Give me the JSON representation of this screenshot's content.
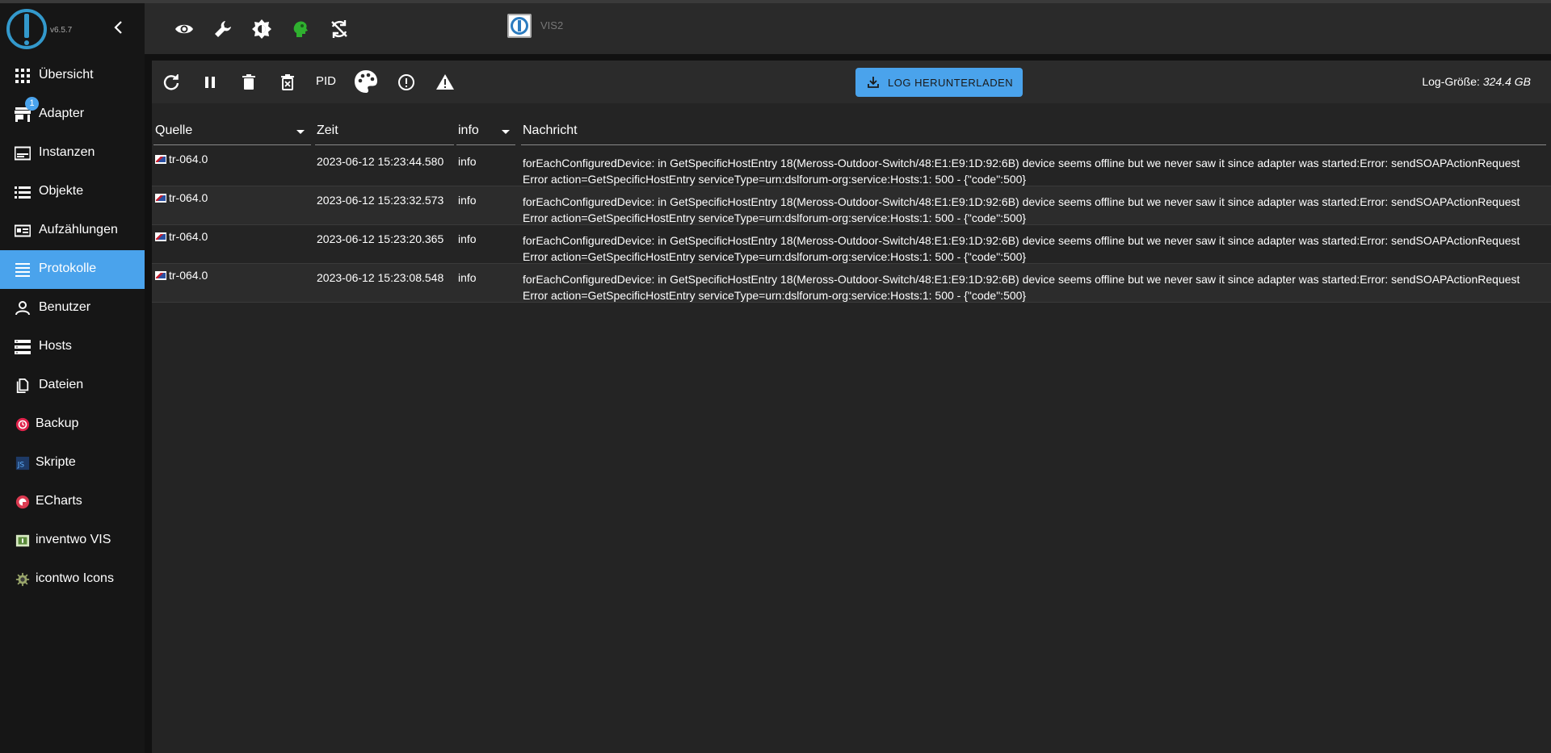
{
  "app": {
    "version": "v6.5.7"
  },
  "sidebar": {
    "items": [
      {
        "label": "Übersicht",
        "icon": "grid-icon"
      },
      {
        "label": "Adapter",
        "icon": "store-icon",
        "badge": "1"
      },
      {
        "label": "Instanzen",
        "icon": "instances-icon"
      },
      {
        "label": "Objekte",
        "icon": "list-icon"
      },
      {
        "label": "Aufzählungen",
        "icon": "enum-icon"
      },
      {
        "label": "Protokolle",
        "icon": "log-icon",
        "active": true
      },
      {
        "label": "Benutzer",
        "icon": "user-icon"
      },
      {
        "label": "Hosts",
        "icon": "hosts-icon"
      },
      {
        "label": "Dateien",
        "icon": "files-icon"
      },
      {
        "label": "Backup",
        "icon": "backup-icon"
      },
      {
        "label": "Skripte",
        "icon": "js-icon"
      },
      {
        "label": "ECharts",
        "icon": "echarts-icon"
      },
      {
        "label": "inventwo VIS",
        "icon": "inventwo-icon"
      },
      {
        "label": "icontwo Icons",
        "icon": "icontwo-icon"
      }
    ]
  },
  "header": {
    "vis2_label": "VIS2"
  },
  "toolbar": {
    "pid_label": "PID",
    "download_label": "LOG HERUNTERLADEN",
    "logsize_label": "Log-Größe:",
    "logsize_value": "324.4 GB"
  },
  "table": {
    "columns": {
      "source": "Quelle",
      "time": "Zeit",
      "severity": "info",
      "message": "Nachricht"
    },
    "rows": [
      {
        "source": "tr-064.0",
        "time": "2023-06-12 15:23:44.580",
        "severity": "info",
        "msg1": "forEachConfiguredDevice: in GetSpecificHostEntry 18(Meross-Outdoor-Switch/48:E1:E9:1D:92:6B) device seems offline but we never saw it since adapter was started:Error: sendSOAPActionRequest",
        "msg2": "Error action=GetSpecificHostEntry serviceType=urn:dslforum-org:service:Hosts:1: 500 - {\"code\":500}"
      },
      {
        "source": "tr-064.0",
        "time": "2023-06-12 15:23:32.573",
        "severity": "info",
        "msg1": "forEachConfiguredDevice: in GetSpecificHostEntry 18(Meross-Outdoor-Switch/48:E1:E9:1D:92:6B) device seems offline but we never saw it since adapter was started:Error: sendSOAPActionRequest",
        "msg2": "Error action=GetSpecificHostEntry serviceType=urn:dslforum-org:service:Hosts:1: 500 - {\"code\":500}"
      },
      {
        "source": "tr-064.0",
        "time": "2023-06-12 15:23:20.365",
        "severity": "info",
        "msg1": "forEachConfiguredDevice: in GetSpecificHostEntry 18(Meross-Outdoor-Switch/48:E1:E9:1D:92:6B) device seems offline but we never saw it since adapter was started:Error: sendSOAPActionRequest",
        "msg2": "Error action=GetSpecificHostEntry serviceType=urn:dslforum-org:service:Hosts:1: 500 - {\"code\":500}"
      },
      {
        "source": "tr-064.0",
        "time": "2023-06-12 15:23:08.548",
        "severity": "info",
        "msg1": "forEachConfiguredDevice: in GetSpecificHostEntry 18(Meross-Outdoor-Switch/48:E1:E9:1D:92:6B) device seems offline but we never saw it since adapter was started:Error: sendSOAPActionRequest",
        "msg2": "Error action=GetSpecificHostEntry serviceType=urn:dslforum-org:service:Hosts:1: 500 - {\"code\":500}"
      }
    ]
  },
  "colors": {
    "accent": "#4aa3ec",
    "background": "#111111",
    "panel": "#242424"
  }
}
